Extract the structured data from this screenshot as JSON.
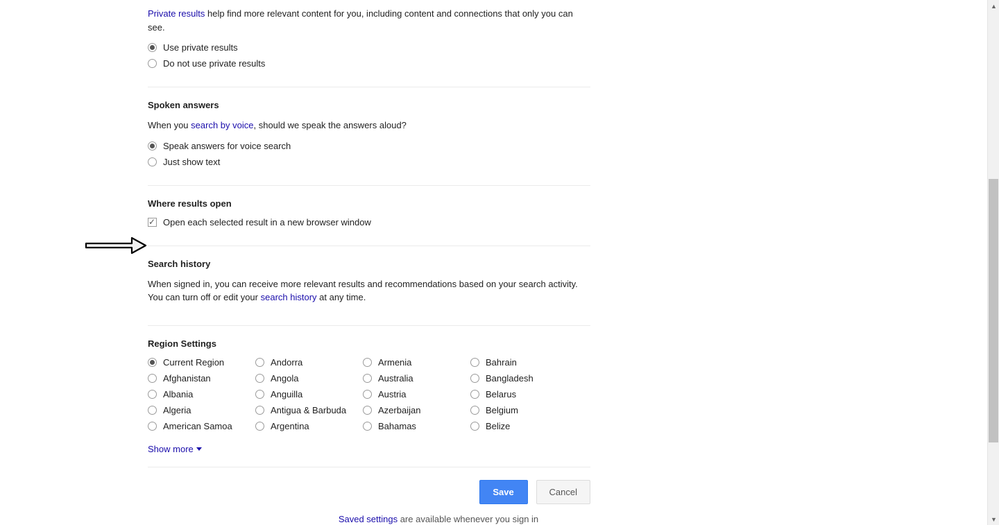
{
  "private": {
    "link": "Private results",
    "desc": " help find more relevant content for you, including content and connections that only you can see.",
    "opt1": "Use private results",
    "opt2": "Do not use private results"
  },
  "spoken": {
    "title": "Spoken answers",
    "desc_pre": "When you ",
    "desc_link": "search by voice",
    "desc_post": ", should we speak the answers aloud?",
    "opt1": "Speak answers for voice search",
    "opt2": "Just show text"
  },
  "where": {
    "title": "Where results open",
    "opt1": "Open each selected result in a new browser window"
  },
  "history": {
    "title": "Search history",
    "desc_pre": "When signed in, you can receive more relevant results and recommendations based on your search activity. You can turn off or edit your ",
    "desc_link": "search history",
    "desc_post": " at any time."
  },
  "region": {
    "title": "Region Settings",
    "cols": [
      [
        "Current Region",
        "Afghanistan",
        "Albania",
        "Algeria",
        "American Samoa"
      ],
      [
        "Andorra",
        "Angola",
        "Anguilla",
        "Antigua & Barbuda",
        "Argentina"
      ],
      [
        "Armenia",
        "Australia",
        "Austria",
        "Azerbaijan",
        "Bahamas"
      ],
      [
        "Bahrain",
        "Bangladesh",
        "Belarus",
        "Belgium",
        "Belize"
      ]
    ],
    "show_more": "Show more"
  },
  "buttons": {
    "save": "Save",
    "cancel": "Cancel"
  },
  "footer": {
    "link": "Saved settings",
    "post": " are available whenever you sign in"
  }
}
